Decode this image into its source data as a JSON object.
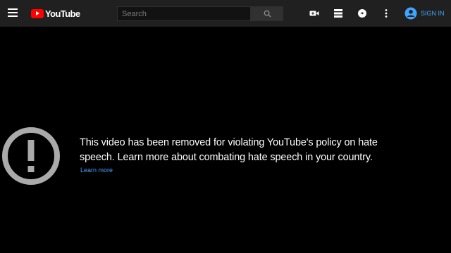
{
  "header": {
    "logo_text": "YouTube",
    "search_placeholder": "Search",
    "signin_label": "Sign in"
  },
  "icons": {
    "menu": "menu-icon",
    "search": "search-icon",
    "create": "video-camera-icon",
    "apps": "apps-grid-icon",
    "messages": "messages-icon",
    "more": "more-vertical-icon",
    "account": "account-circle-icon",
    "alert": "alert-circle-icon"
  },
  "colors": {
    "topbar": "#202020",
    "background": "#000000",
    "link": "#3ea6ff",
    "brand": "#ff0000",
    "alert_icon": "#aaaaaa"
  },
  "error": {
    "message_line1": "This video has been removed for violating YouTube's policy on hate",
    "message_line2": "speech. Learn more about combating hate speech in your country.",
    "learn_more": "Learn more"
  }
}
